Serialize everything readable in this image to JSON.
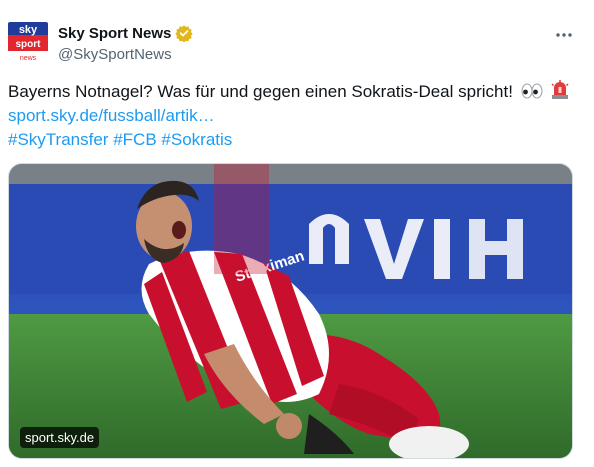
{
  "account": {
    "display_name": "Sky Sport News",
    "handle": "@SkySportNews",
    "verified_badge_color": "#e2b719",
    "logo_text": {
      "top": "sky",
      "middle": "sport",
      "bottom": "news"
    }
  },
  "tweet": {
    "text": "Bayerns Notnagel? Was für und gegen einen Sokratis-Deal spricht!",
    "emojis": [
      "eyes-emoji",
      "rotating-light-emoji"
    ],
    "link": "sport.sky.de/fussball/artik…",
    "hashtags": [
      "#SkyTransfer",
      "#FCB",
      "#Sokratis"
    ]
  },
  "media": {
    "source_label": "sport.sky.de",
    "description_icon": "football-player-celebrating-photo",
    "jersey_text": "Stoiximan"
  },
  "colors": {
    "link": "#1d9bf0",
    "text": "#0f1419",
    "muted": "#536471",
    "jersey_red": "#c8102e",
    "pitch_green": "#3f8a3a",
    "stadium_blue": "#2d4fb8"
  },
  "icons": {
    "more": "more-dots-icon",
    "verified": "verified-badge-icon"
  }
}
